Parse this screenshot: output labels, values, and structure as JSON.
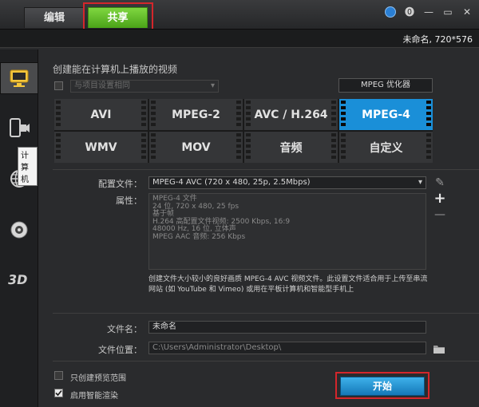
{
  "tabs": {
    "edit": "编辑",
    "share": "共享"
  },
  "window_icons": [
    "globe-icon",
    "help-icon",
    "minimize-icon",
    "restore-icon",
    "close-icon"
  ],
  "window_glyphs": {
    "help": "⓿",
    "minimize": "—",
    "restore": "▭",
    "close": "✕"
  },
  "project_info": "未命名, 720*576",
  "sidebar": {
    "items": [
      "computer-icon",
      "device-icon",
      "web-icon",
      "disc-icon",
      "3d-icon"
    ],
    "tooltip": "计算机",
    "three_d": "3D"
  },
  "main": {
    "heading": "创建能在计算机上播放的视频",
    "profile_select": "与项目设置相同",
    "optimizer_button": "MPEG 优化器",
    "formats": [
      "AVI",
      "MPEG-2",
      "AVC / H.264",
      "MPEG-4",
      "WMV",
      "MOV",
      "音频",
      "自定义"
    ],
    "selected_format": "MPEG-4",
    "config_label": "配置文件：",
    "config_value": "MPEG-4 AVC (720 x 480, 25p, 2.5Mbps)",
    "props_label": "属性：",
    "props_lines": [
      "MPEG-4 文件",
      "24 位, 720 x 480, 25 fps",
      "基于帧",
      "H.264 高配置文件视频: 2500 Kbps, 16:9",
      "48000 Hz, 16 位, 立体声",
      "MPEG AAC 音频: 256 Kbps"
    ],
    "description": "创建文件大小较小的良好画质 MPEG-4 AVC 视频文件。此设置文件适合用于上传至串流网站 (如 YouTube 和 Vimeo) 或用在平板计算机和智能型手机上",
    "filename_label": "文件名：",
    "filename_value": "未命名",
    "location_label": "文件位置：",
    "location_value": "C:\\Users\\Administrator\\Desktop\\",
    "preview_only_label": "只创建预览范围",
    "smart_render_label": "启用智能渲染",
    "smart_render_checked": true,
    "preview_only_checked": false,
    "start_button": "开始"
  },
  "colors": {
    "accent": "#1a8fd8",
    "share_tab": "#5cb82a",
    "highlight": "#d4262b"
  }
}
